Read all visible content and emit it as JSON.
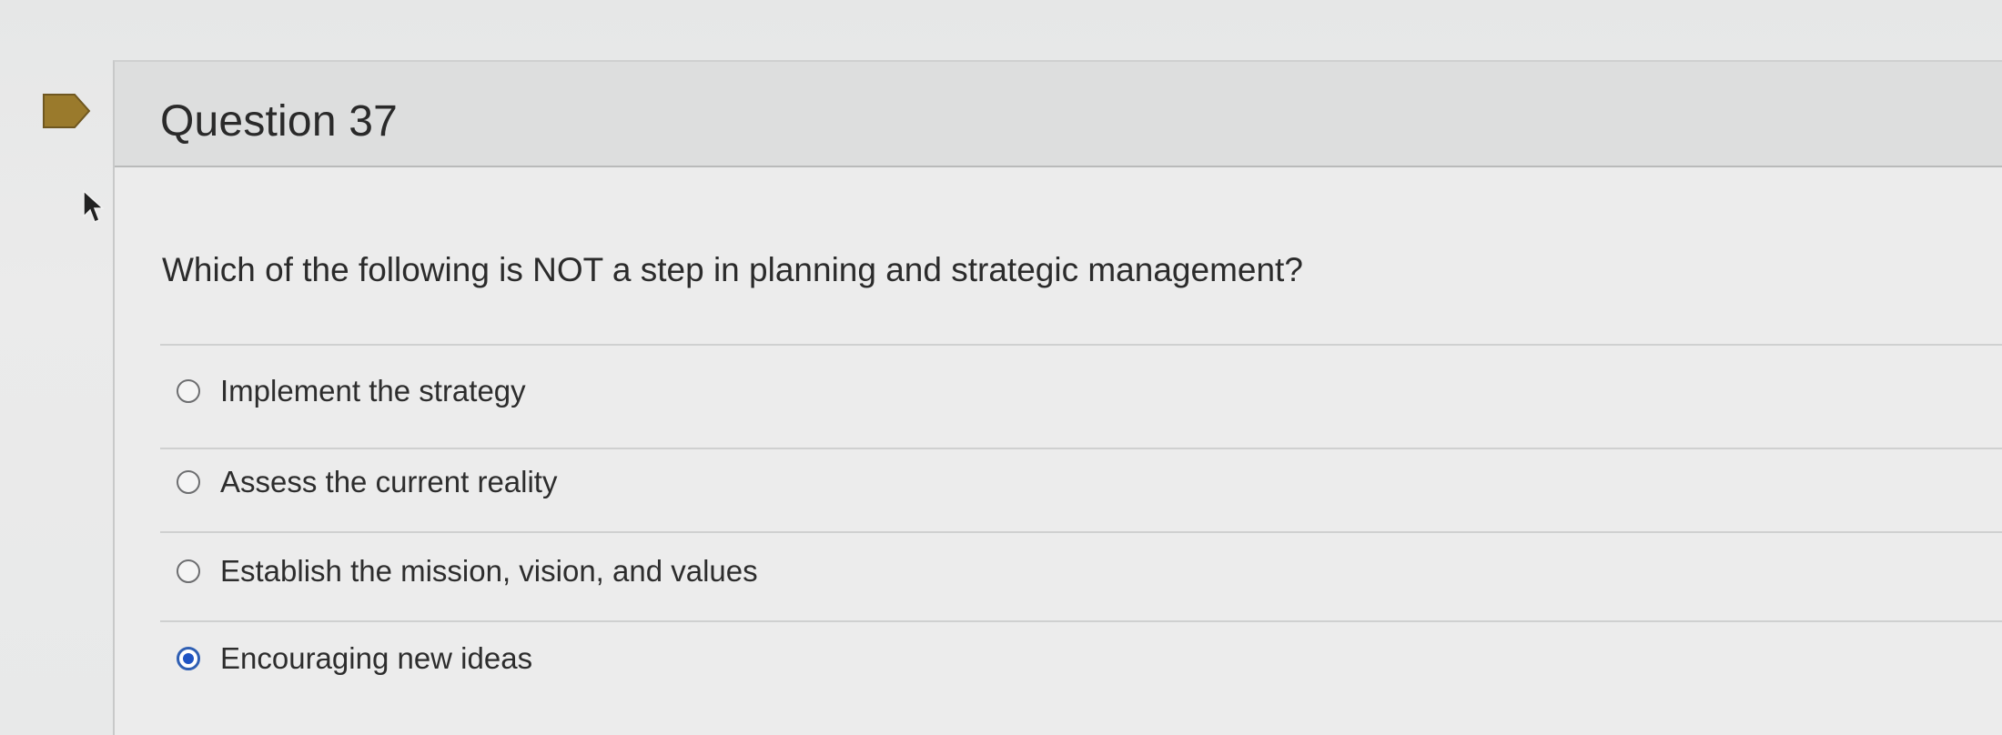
{
  "question": {
    "title": "Question 37",
    "prompt": "Which of the following is NOT a step in planning and strategic management?",
    "options": [
      {
        "label": "Implement the strategy",
        "selected": false
      },
      {
        "label": "Assess the current reality",
        "selected": false
      },
      {
        "label": "Establish the mission, vision, and values",
        "selected": false
      },
      {
        "label": "Encouraging new ideas",
        "selected": true
      }
    ]
  },
  "colors": {
    "flag": "#9a7a2c",
    "selected_radio": "#1f54c4"
  },
  "icons": {
    "flag": "flag-icon",
    "cursor": "mouse-pointer-icon"
  }
}
